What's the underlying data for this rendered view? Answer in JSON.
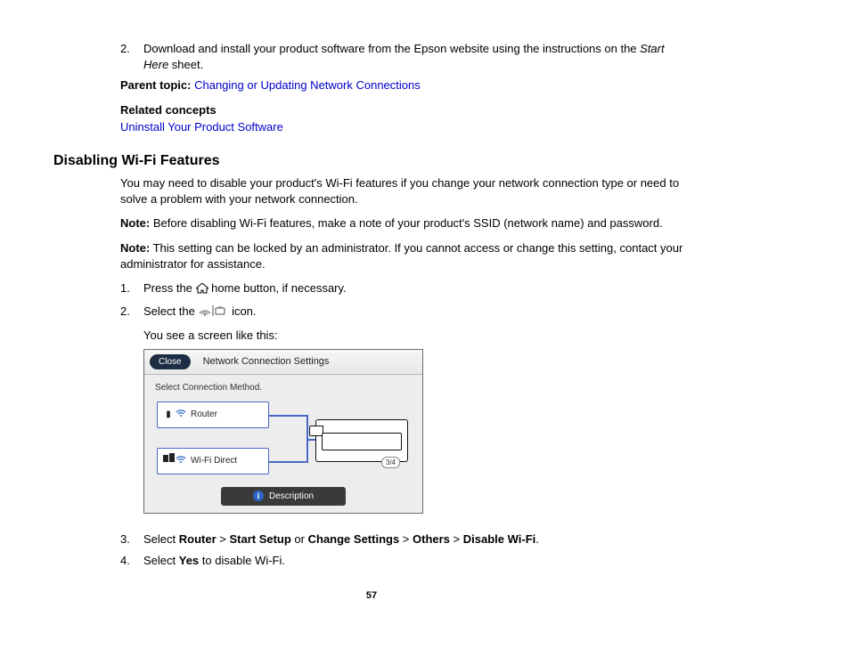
{
  "top_list": {
    "num": "2.",
    "text_a": "Download and install your product software from the Epson website using the instructions on the ",
    "text_b": "Start Here",
    "text_c": " sheet."
  },
  "parent_topic": {
    "label": "Parent topic:",
    "link": "Changing or Updating Network Connections"
  },
  "related": {
    "label": "Related concepts",
    "link": "Uninstall Your Product Software"
  },
  "section_title": "Disabling Wi-Fi Features",
  "intro": "You may need to disable your product's Wi-Fi features if you change your network connection type or need to solve a problem with your network connection.",
  "note1": {
    "label": "Note:",
    "text": " Before disabling Wi-Fi features, make a note of your product's SSID (network name) and password."
  },
  "note2": {
    "label": "Note:",
    "text": " This setting can be locked by an administrator. If you cannot access or change this setting, contact your administrator for assistance."
  },
  "steps": {
    "s1": {
      "num": "1.",
      "a": "Press the ",
      "b": " home button, if necessary."
    },
    "s2": {
      "num": "2.",
      "a": "Select the ",
      "b": " icon.",
      "c": "You see a screen like this:"
    },
    "s3": {
      "num": "3.",
      "a": "Select ",
      "router": "Router",
      "gt1": " > ",
      "start": "Start Setup",
      "or": " or ",
      "change": "Change Settings",
      "gt2": " > ",
      "others": "Others",
      "gt3": " > ",
      "disable": "Disable Wi-Fi",
      "end": "."
    },
    "s4": {
      "num": "4.",
      "a": "Select ",
      "yes": "Yes",
      "b": " to disable Wi-Fi."
    }
  },
  "lcd": {
    "close": "Close",
    "title": "Network Connection Settings",
    "instruction": "Select Connection Method.",
    "router": "Router",
    "direct": "Wi-Fi Direct",
    "badge": "3/4",
    "description": "Description"
  },
  "page_number": "57"
}
